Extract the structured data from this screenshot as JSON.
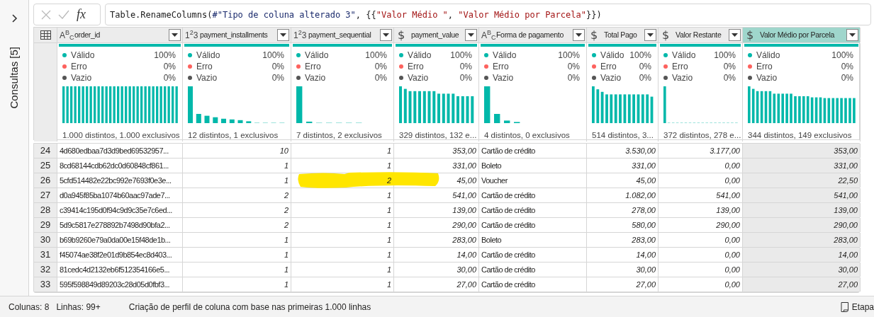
{
  "queries_panel": {
    "title": "Consultas [5]",
    "expanded": false
  },
  "formula_bar": {
    "fx_label": "fx",
    "tokens": [
      {
        "text": "Table.RenameColumns(",
        "kind": "plain"
      },
      {
        "text": "#\"Tipo de coluna alterado 3\"",
        "kind": "identifier"
      },
      {
        "text": ", {{",
        "kind": "plain"
      },
      {
        "text": "\"Valor Médio \"",
        "kind": "string"
      },
      {
        "text": ", ",
        "kind": "plain"
      },
      {
        "text": "\"Valor Médio por Parcela\"",
        "kind": "string"
      },
      {
        "text": "}})",
        "kind": "plain"
      }
    ]
  },
  "table": {
    "columns": [
      {
        "name": "order_id",
        "kind": "text",
        "type_icon": "A$^{B}$$_{C}$",
        "selected": false,
        "valid_label": "Válido",
        "valid": "100%",
        "error_label": "Erro",
        "error": "0%",
        "empty_label": "Vazio",
        "empty": "0%",
        "distinct": "1.000 distintos, 1.000 exclusivos"
      },
      {
        "name": "payment_installments",
        "kind": "number",
        "type_icon": "1$^{2}$3",
        "selected": false,
        "valid_label": "Válido",
        "valid": "100%",
        "error_label": "Erro",
        "error": "0%",
        "empty_label": "Vazio",
        "empty": "0%",
        "distinct": "12 distintos, 1 exclusivos"
      },
      {
        "name": "payment_sequential",
        "kind": "number",
        "type_icon": "1$^{2}$3",
        "selected": false,
        "valid_label": "Válido",
        "valid": "100%",
        "error_label": "Erro",
        "error": "0%",
        "empty_label": "Vazio",
        "empty": "0%",
        "distinct": "7 distintos, 2 exclusivos"
      },
      {
        "name": "payment_value",
        "kind": "currency",
        "type_icon": "$",
        "selected": false,
        "valid_label": "Válido",
        "valid": "100%",
        "error_label": "Erro",
        "error": "0%",
        "empty_label": "Vazio",
        "empty": "0%",
        "distinct": "329 distintos, 132 e..."
      },
      {
        "name": "Forma de pagamento",
        "kind": "text",
        "type_icon": "A$^{B}$$_{C}$",
        "selected": false,
        "valid_label": "Válido",
        "valid": "100%",
        "error_label": "Erro",
        "error": "0%",
        "empty_label": "Vazio",
        "empty": "0%",
        "distinct": "4 distintos, 0 exclusivos"
      },
      {
        "name": "Total Pago",
        "kind": "currency",
        "type_icon": "$",
        "selected": false,
        "valid_label": "Válido",
        "valid": "100%",
        "error_label": "Erro",
        "error": "0%",
        "empty_label": "Vazio",
        "empty": "0%",
        "distinct": "514 distintos, 3..."
      },
      {
        "name": "Valor Restante",
        "kind": "currency",
        "type_icon": "$",
        "selected": false,
        "valid_label": "Válido",
        "valid": "100%",
        "error_label": "Erro",
        "error": "0%",
        "empty_label": "Vazio",
        "empty": "0%",
        "distinct": "372 distintos, 278 e..."
      },
      {
        "name": "Valor Médio por Parcela",
        "kind": "currency",
        "type_icon": "$",
        "selected": true,
        "valid_label": "Válido",
        "valid": "100%",
        "error_label": "Erro",
        "error": "0%",
        "empty_label": "Vazio",
        "empty": "0%",
        "distinct": "344 distintos, 149 exclusivos"
      }
    ],
    "rows": [
      {
        "number": "24",
        "highlighted": false,
        "cells": [
          "4d680edbaa7d3d9bed69532957...",
          "10",
          "1",
          "353,00",
          "Cartão de crédito",
          "3.530,00",
          "3.177,00",
          "353,00"
        ]
      },
      {
        "number": "25",
        "highlighted": false,
        "cells": [
          "8cd68144cdb62dc0d60848cf861...",
          "1",
          "1",
          "331,00",
          "Boleto",
          "331,00",
          "0,00",
          "331,00"
        ]
      },
      {
        "number": "26",
        "highlighted": true,
        "cells": [
          "5cfd514482e22bc992e7693f0e3e...",
          "1",
          "2",
          "45,00",
          "Voucher",
          "45,00",
          "0,00",
          "22,50"
        ]
      },
      {
        "number": "27",
        "highlighted": false,
        "cells": [
          "d0a945f85ba1074b60aac97ade7...",
          "2",
          "1",
          "541,00",
          "Cartão de crédito",
          "1.082,00",
          "541,00",
          "541,00"
        ]
      },
      {
        "number": "28",
        "highlighted": false,
        "cells": [
          "c39414c195d0f94c9d9c35e7c6ed...",
          "2",
          "1",
          "139,00",
          "Cartão de crédito",
          "278,00",
          "139,00",
          "139,00"
        ]
      },
      {
        "number": "29",
        "highlighted": false,
        "cells": [
          "5d9c5817e278892b7498d90bfa2...",
          "2",
          "1",
          "290,00",
          "Cartão de crédito",
          "580,00",
          "290,00",
          "290,00"
        ]
      },
      {
        "number": "30",
        "highlighted": false,
        "cells": [
          "b69b9260e79a0da00e15f48de1b...",
          "1",
          "1",
          "283,00",
          "Boleto",
          "283,00",
          "0,00",
          "283,00"
        ]
      },
      {
        "number": "31",
        "highlighted": false,
        "cells": [
          "f45074ae38f2e01d9b854ec8d403...",
          "1",
          "1",
          "14,00",
          "Cartão de crédito",
          "14,00",
          "0,00",
          "14,00"
        ]
      },
      {
        "number": "32",
        "highlighted": false,
        "cells": [
          "81cedc4d2132eb6f512354166e5...",
          "1",
          "1",
          "30,00",
          "Cartão de crédito",
          "30,00",
          "0,00",
          "30,00"
        ]
      },
      {
        "number": "33",
        "highlighted": false,
        "cells": [
          "595f598849d89203c28d05d0fbf3...",
          "1",
          "1",
          "27,00",
          "Cartão de crédito",
          "27,00",
          "0,00",
          "27,00"
        ]
      }
    ]
  },
  "status_bar": {
    "columns": "Colunas: 8",
    "rows": "Linhas: 99+",
    "profiling": "Criação de perfil de coluna com base nas primeiras 1.000 linhas",
    "steps": "Etapa"
  }
}
